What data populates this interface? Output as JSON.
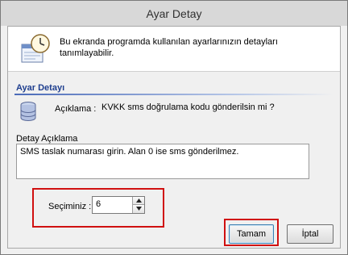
{
  "window": {
    "title": "Ayar Detay"
  },
  "header": {
    "text": "Bu ekranda programda kullanılan ayarlarınızın detayları tanımlayabilir."
  },
  "section": {
    "title": "Ayar Detayı"
  },
  "aciklama": {
    "label": "Açıklama :",
    "value": "KVKK sms doğrulama kodu gönderilsin mi ?"
  },
  "detay": {
    "label": "Detay Açıklama",
    "value": "SMS taslak numarası girin. Alan 0 ise sms gönderilmez."
  },
  "secim": {
    "label": "Seçiminiz :",
    "value": "6"
  },
  "buttons": {
    "ok_label": "Tamam",
    "cancel_label": "İptal"
  },
  "colors": {
    "highlight": "#d01010",
    "section_title": "#1f3f8f",
    "titlebar": "#d8d8d8"
  },
  "icons": {
    "header": "clock-document-icon",
    "database": "database-icon"
  }
}
